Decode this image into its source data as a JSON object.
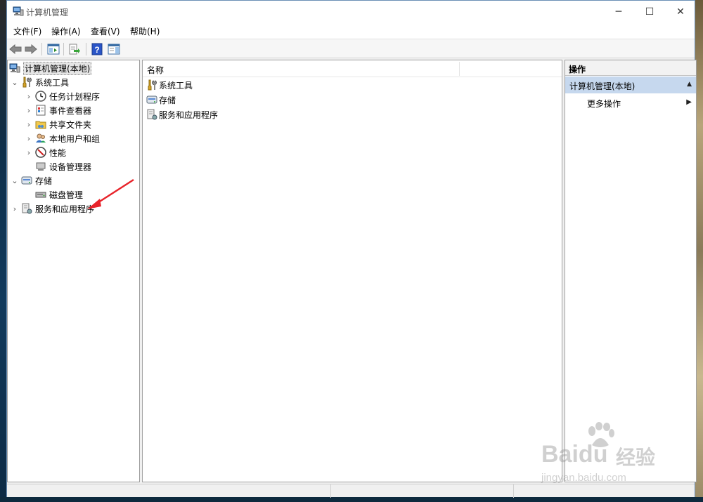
{
  "window": {
    "title": "计算机管理",
    "controls": {
      "minimize": "─",
      "maximize": "☐",
      "close": "✕"
    }
  },
  "menubar": {
    "items": [
      "文件(F)",
      "操作(A)",
      "查看(V)",
      "帮助(H)"
    ]
  },
  "toolbar": {
    "buttons": [
      "back-icon",
      "forward-icon",
      "show-hide-tree-icon",
      "export-list-icon",
      "help-icon",
      "show-hide-action-pane-icon"
    ]
  },
  "tree": {
    "root": "计算机管理(本地)",
    "system_tools": {
      "label": "系统工具",
      "children": [
        "任务计划程序",
        "事件查看器",
        "共享文件夹",
        "本地用户和组",
        "性能",
        "设备管理器"
      ]
    },
    "storage": {
      "label": "存储",
      "children": [
        "磁盘管理"
      ]
    },
    "services": {
      "label": "服务和应用程序"
    }
  },
  "center": {
    "column_name": "名称",
    "items": [
      "系统工具",
      "存储",
      "服务和应用程序"
    ]
  },
  "actions": {
    "header": "操作",
    "section": "计算机管理(本地)",
    "more": "更多操作"
  },
  "watermark": {
    "brand": "Bai",
    "brand2": "du",
    "cn": "经验",
    "url": "jingyan.baidu.com"
  },
  "colors": {
    "selection": "#c6d8ee",
    "annotation_arrow": "#e8232a"
  }
}
